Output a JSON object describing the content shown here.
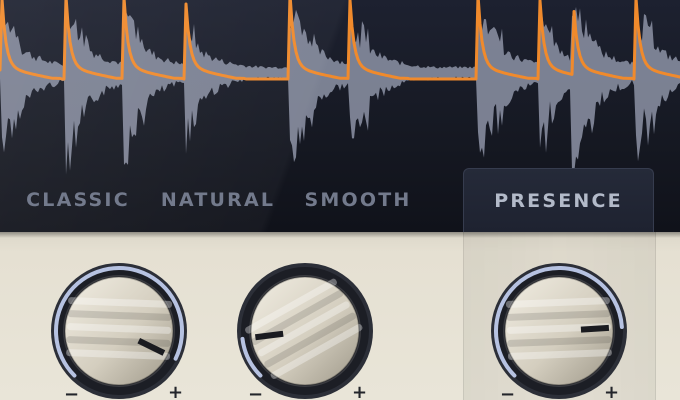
{
  "modes": [
    {
      "label": "CLASSIC",
      "active": false
    },
    {
      "label": "NATURAL",
      "active": false
    },
    {
      "label": "SMOOTH",
      "active": false
    },
    {
      "label": "PRESENCE",
      "active": true
    }
  ],
  "knobs": [
    {
      "name": "knob-1",
      "value": 0.93,
      "minus": "−",
      "plus": "+"
    },
    {
      "name": "knob-2",
      "value": 0.14,
      "minus": "−",
      "plus": "+"
    },
    {
      "name": "knob-3",
      "value": 0.82,
      "minus": "−",
      "plus": "+"
    }
  ],
  "colors": {
    "accent_curve": "#f08a2c",
    "waveform": "#8d93a6",
    "arc_glow": "#c8d4f6",
    "knob_body": "#d4cebf",
    "panel": "#e6e1d4"
  }
}
